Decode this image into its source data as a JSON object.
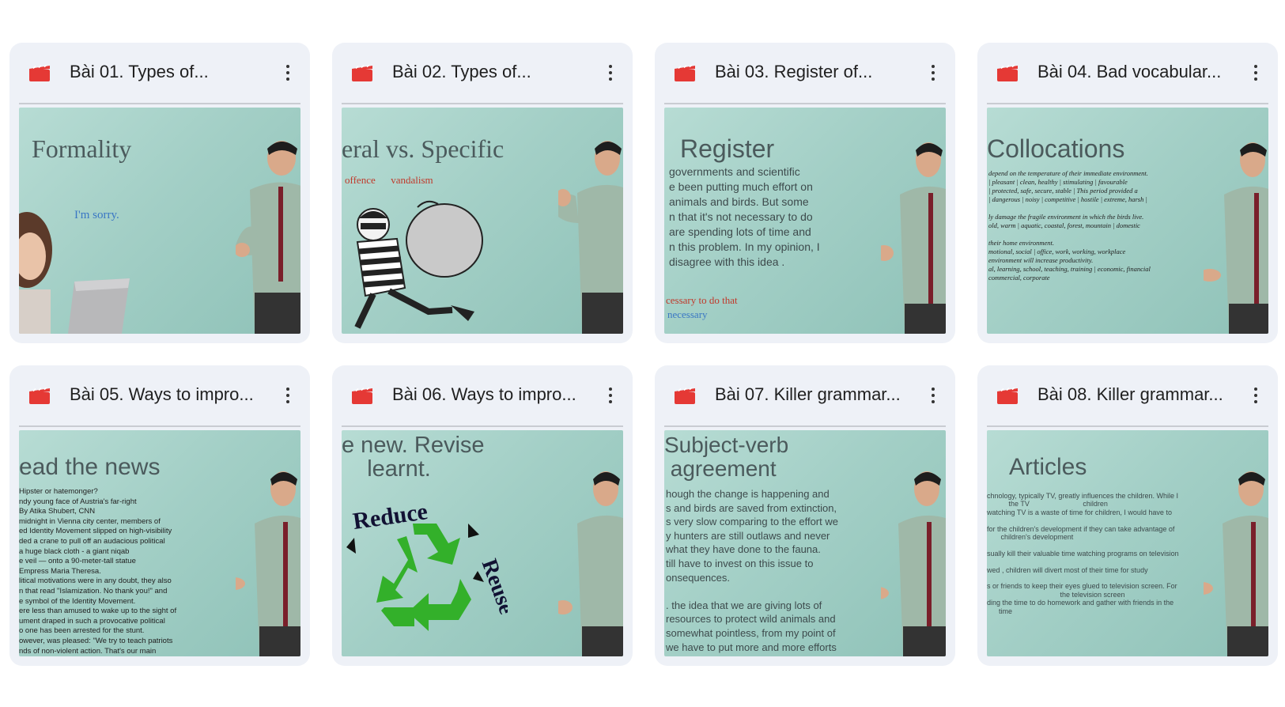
{
  "cards": [
    {
      "title": "Bài 01. Types of...",
      "slide_title": "Formality",
      "slide_text": "",
      "red_text": "",
      "blue_text": "I'm sorry.",
      "thumb_kind": "formality"
    },
    {
      "title": "Bài 02. Types of...",
      "slide_title": "eral vs. Specific",
      "slide_text": "",
      "red_text": "offence      vandalism",
      "blue_text": "",
      "thumb_kind": "thief"
    },
    {
      "title": "Bài 03. Register of...",
      "slide_title": "Register",
      "slide_text": "governments and scientific\ne been putting much effort on\nanimals and birds. But some\nn that it's not necessary to do\nare spending lots of time and\nn this problem. In my opinion, I\ndisagree with this idea .",
      "red_text": "cessary to do that",
      "blue_text": "necessary",
      "thumb_kind": "text"
    },
    {
      "title": "Bài 04. Bad vocabular...",
      "slide_title": "Collocations",
      "slide_text": "depend on the temperature of their immediate environment.\n| pleasant | clean, healthy | stimulating | favourable\n| protected, safe, secure, stable | This period provided a\n| dangerous | noisy | competitive | hostile | extreme, harsh |\n\nly damage the fragile environment in which the birds live.\nold, warm | aquatic, coastal, forest, mountain | domestic\n\ntheir home environment.\nmotional, social | office, work, working, workplace\nenvironment will increase productivity.\nal, learning, school, teaching, training | economic, financial\ncommercial, corporate",
      "red_text": "",
      "blue_text": "",
      "thumb_kind": "small"
    },
    {
      "title": "Bài 05. Ways to impro...",
      "slide_title": "ead the news",
      "slide_text": "Hipster or hatemonger?\nndy young face of Austria's far-right\nBy Atika Shubert, CNN\nmidnight in Vienna city center, members of\ned Identity Movement slipped on high-visibility\nded a crane to pull off an audacious political\na huge black cloth - a giant niqab\ne veil — onto a 90-meter-tall statue\nEmpress Maria Theresa.\nlitical motivations were in any doubt, they also\nn that read \"Islamization. No thank you!\" and\ne symbol of the Identity Movement.\nere less than amused to wake up to the sight of\nument draped in such a provocative political\no one has been arrested for the stunt.\nowever, was pleased: \"We try to teach patriots\nnds of non-violent action. That's our main\nence. No real hate speech.\"",
      "red_text": "",
      "blue_text": "",
      "thumb_kind": "small"
    },
    {
      "title": "Bài 06. Ways to impro...",
      "slide_title": "e new. Revise\n    learnt.",
      "slide_text": "",
      "red_text": "",
      "blue_text": "",
      "recycle_top": "Reduce",
      "recycle_side": "Reuse",
      "thumb_kind": "recycle"
    },
    {
      "title": "Bài 07. Killer grammar...",
      "slide_title": "Subject-verb\n agreement",
      "slide_text": "hough the change is happening and\ns and birds are saved from extinction,\ns very slow comparing to the effort we\ny hunters are still outlaws and never\nwhat they have done to the fauna.\ntill have to invest on this issue to\nonsequences.\n\n. the idea that we are giving lots of\nresources to protect wild animals and\nsomewhat pointless, from my point of\nwe have to put more and more efforts",
      "red_text": "",
      "blue_text": "",
      "thumb_kind": "text2"
    },
    {
      "title": "Bài 08. Killer grammar...",
      "slide_title": "Articles",
      "slide_text": "chnology, typically TV, greatly influences the children. While I\n           the TV                           children\nwatching TV is a waste of time for children, I would have to\n\nfor the children's development if they can take advantage of\n       children's development\n\nsually kill their valuable time watching programs on television\n\nwed , children will divert most of their time for study\n\ns or friends to keep their eyes glued to television screen. For\n                                     the television screen\nding the time to do homework and gather with friends in the\n      time",
      "red_text": "",
      "blue_text": "",
      "thumb_kind": "small2"
    }
  ],
  "colors": {
    "card_bg": "#eef1f7",
    "icon_red": "#e53935",
    "slide_bg": "#a9d3ca"
  },
  "icons": {
    "card_type": "video-clapper-icon",
    "menu": "more-vert-icon"
  }
}
